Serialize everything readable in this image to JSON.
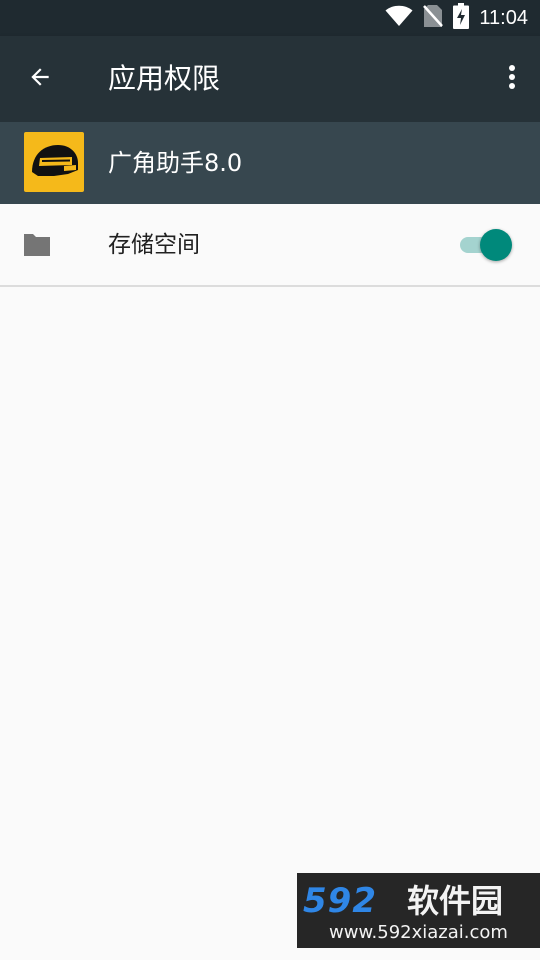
{
  "status_bar": {
    "time": "11:04",
    "icons": [
      "wifi-icon",
      "no-sim-icon",
      "battery-charging-icon"
    ]
  },
  "toolbar": {
    "title": "应用权限",
    "back_icon": "arrow-back-icon",
    "more_icon": "more-vert-icon"
  },
  "app": {
    "name": "广角助手8.0",
    "icon": "helmet-icon",
    "icon_bg": "#f5b91a"
  },
  "permissions": [
    {
      "label": "存储空间",
      "icon": "folder-icon",
      "enabled": true
    }
  ],
  "colors": {
    "toolbar": "#263238",
    "app_header": "#37474f",
    "switch_on": "#00897b"
  },
  "watermark": {
    "brand": "592",
    "brand_cn": "软件园",
    "url": "www.592xiazai.com"
  }
}
